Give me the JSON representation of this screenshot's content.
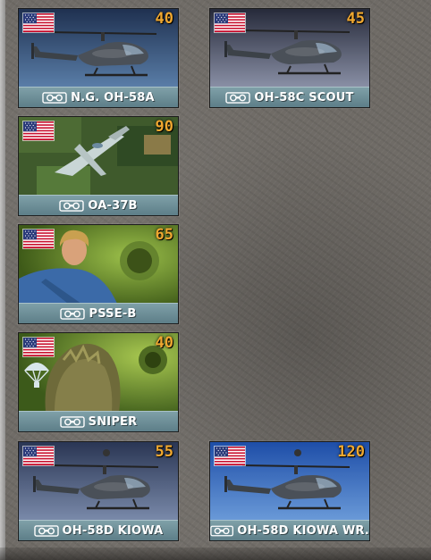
{
  "cards": [
    {
      "name": "N.G. OH-58A",
      "cost": "40",
      "flag": "usa-flag",
      "category_icon": "recon-binoculars-icon",
      "art": "helicopter"
    },
    {
      "name": "OH-58C SCOUT",
      "cost": "45",
      "flag": "usa-flag",
      "category_icon": "recon-binoculars-icon",
      "art": "helicopter"
    },
    {
      "name": "OA-37B",
      "cost": "90",
      "flag": "usa-flag",
      "category_icon": "recon-binoculars-icon",
      "art": "jet"
    },
    {
      "name": "PSSE-B",
      "cost": "65",
      "flag": "usa-flag",
      "category_icon": "recon-binoculars-icon",
      "art": "soldier"
    },
    {
      "name": "SNIPER",
      "cost": "40",
      "flag": "usa-flag",
      "category_icon": "recon-binoculars-icon",
      "extra_icon": "parachute-icon",
      "art": "ghillie"
    },
    {
      "name": "OH-58D KIOWA",
      "cost": "55",
      "flag": "usa-flag",
      "category_icon": "recon-binoculars-icon",
      "art": "helicopter"
    },
    {
      "name": "OH-58D KIOWA WR.",
      "cost": "120",
      "flag": "usa-flag",
      "category_icon": "recon-binoculars-icon",
      "art": "helicopter"
    }
  ],
  "colors": {
    "cost": "#f0a830",
    "label_bar": "#6f909a"
  }
}
